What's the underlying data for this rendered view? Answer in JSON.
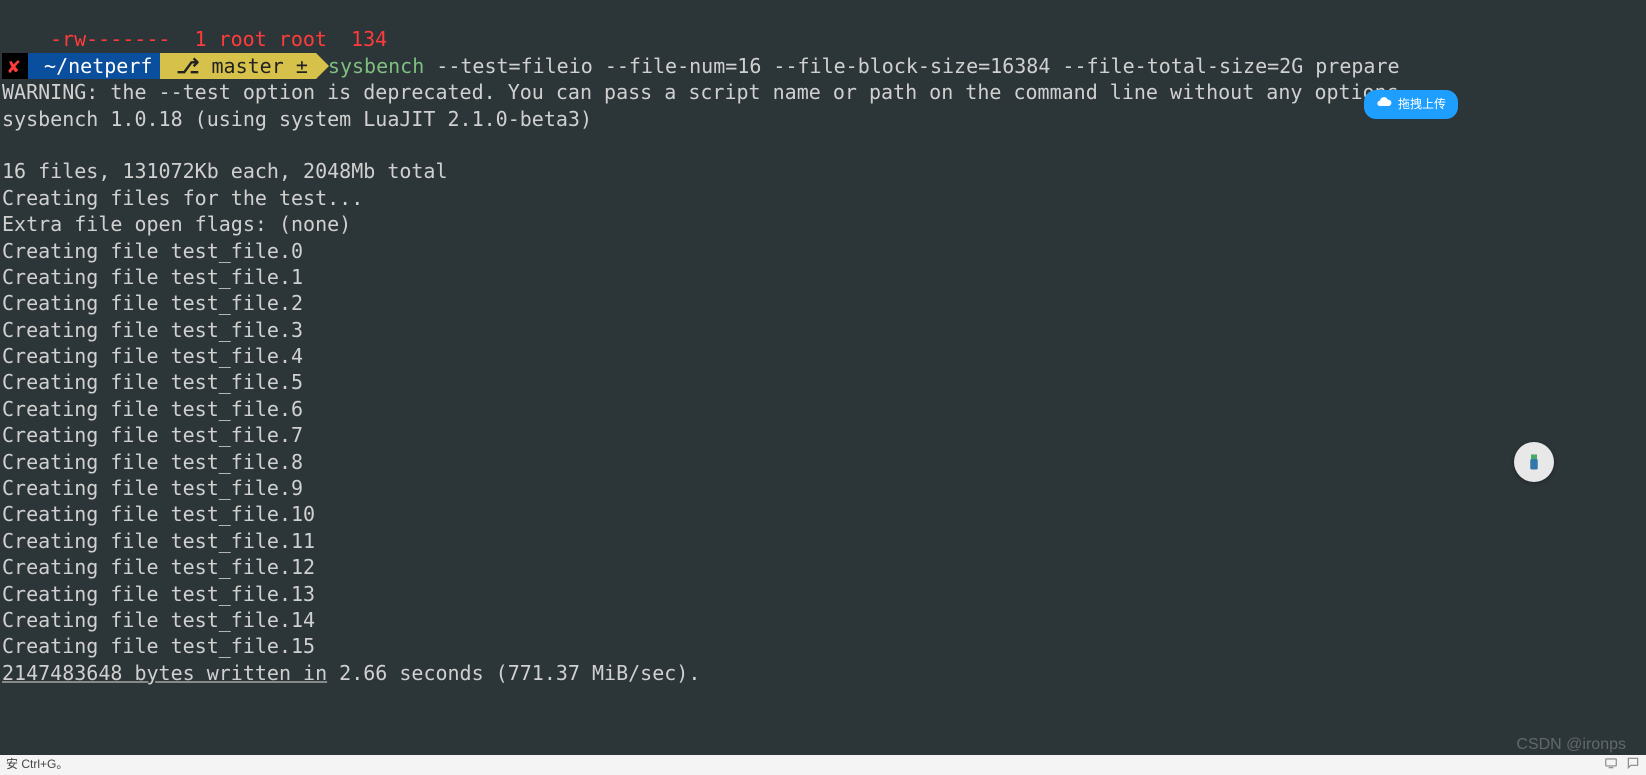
{
  "top_partial": "-rw-------  1 root root  134",
  "prompt": {
    "close": "✘",
    "cwd": "~/netperf",
    "branch_icon": "⎇",
    "branch": "master",
    "dirty": "±",
    "cmd_bin": "sysbench",
    "cmd_args": " --test=fileio --file-num=16 --file-block-size=16384 --file-total-size=2G prepare"
  },
  "output": {
    "warn": "WARNING: the --test option is deprecated. You can pass a script name or path on the command line without any options.",
    "version": "sysbench 1.0.18 (using system LuaJIT 2.1.0-beta3)",
    "summary": "16 files, 131072Kb each, 2048Mb total",
    "creating": "Creating files for the test...",
    "flags": "Extra file open flags: (none)",
    "files": [
      "Creating file test_file.0",
      "Creating file test_file.1",
      "Creating file test_file.2",
      "Creating file test_file.3",
      "Creating file test_file.4",
      "Creating file test_file.5",
      "Creating file test_file.6",
      "Creating file test_file.7",
      "Creating file test_file.8",
      "Creating file test_file.9",
      "Creating file test_file.10",
      "Creating file test_file.11",
      "Creating file test_file.12",
      "Creating file test_file.13",
      "Creating file test_file.14",
      "Creating file test_file.15"
    ],
    "result_ul": "2147483648 bytes written in",
    "result_rest": " 2.66 seconds (771.37 MiB/sec)."
  },
  "upload_label": "拖拽上传",
  "statusbar_left": "安 Ctrl+G。",
  "watermark": "CSDN @ironps"
}
